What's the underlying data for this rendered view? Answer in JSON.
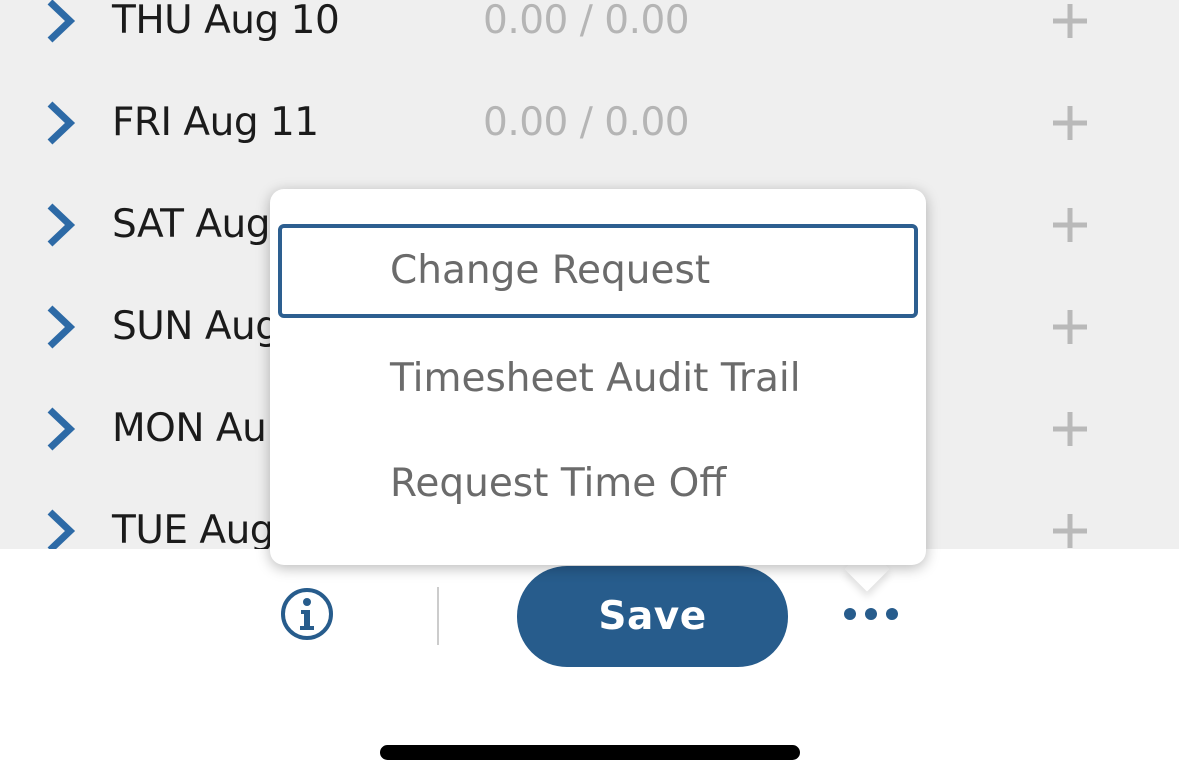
{
  "days": [
    {
      "label": "THU Aug 10",
      "hours": "0.00 / 0.00"
    },
    {
      "label": "FRI Aug 11",
      "hours": "0.00 / 0.00"
    },
    {
      "label": "SAT Aug",
      "hours": ""
    },
    {
      "label": "SUN Aug",
      "hours": ""
    },
    {
      "label": "MON Au",
      "hours": ""
    },
    {
      "label": "TUE Aug",
      "hours": ""
    }
  ],
  "menu": {
    "items": [
      {
        "label": "Change Request"
      },
      {
        "label": "Timesheet Audit Trail"
      },
      {
        "label": "Request Time Off"
      }
    ]
  },
  "toolbar": {
    "save_label": "Save",
    "info_icon": "info-icon",
    "more_icon": "more-horizontal-icon"
  },
  "colors": {
    "accent": "#275c8c",
    "list_background": "#efefef",
    "chevron": "#2d6aa6",
    "plus": "#b9b9b9"
  }
}
